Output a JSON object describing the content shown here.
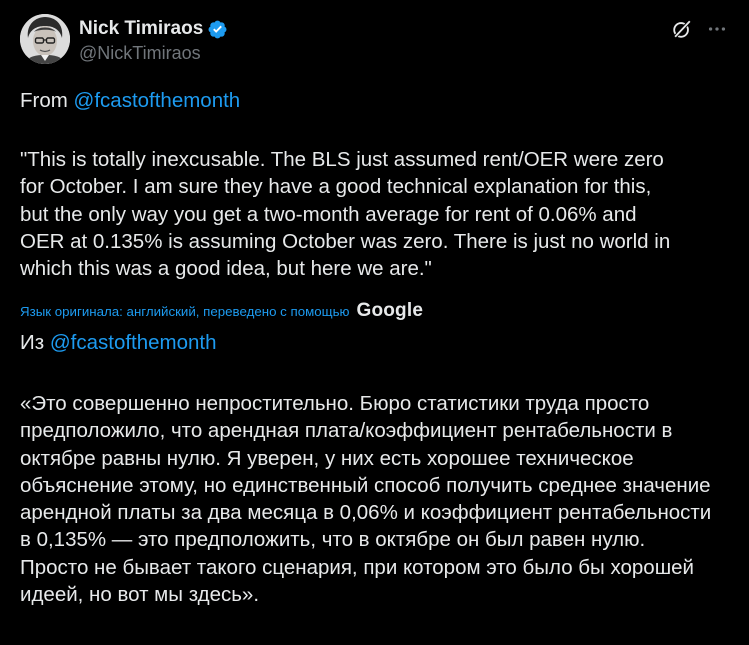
{
  "author": {
    "name": "Nick Timiraos",
    "handle": "@NickTimiraos"
  },
  "icons": {
    "verified": "verified-badge-icon",
    "grok": "grok-icon",
    "more": "more-icon",
    "verified_color": "#1d9bf0",
    "link_color": "#1d9bf0"
  },
  "tweet": {
    "from_prefix": "From ",
    "from_mention": "@fcastofthemonth",
    "quote_lines": [
      "\"This is totally inexcusable. The BLS just assumed rent/OER were zero",
      "for October. I am sure they have a good technical explanation for this,",
      "but the only way you get a two-month average for rent of 0.06% and",
      "OER at 0.135% is assuming October was zero. There is just no world in",
      "which this was a good idea, but here we are.\""
    ],
    "translation_note": "Язык оригинала: английский, переведено с помощью",
    "translation_brand": "Google",
    "from_ru_prefix": "Из ",
    "from_ru_mention": "@fcastofthemonth",
    "quote_ru_lines": [
      "«Это совершенно непростительно. Бюро статистики труда просто",
      "предположило, что арендная плата/коэффициент рентабельности в",
      "октябре равны нулю. Я уверен, у них есть хорошее техническое",
      "объяснение этому, но единственный способ получить среднее значение",
      "арендной платы за два месяца в 0,06% и коэффициент рентабельности",
      "в 0,135% — это предположить, что в октябре он был равен нулю.",
      "Просто не бывает такого сценария, при котором это было бы хорошей",
      "идеей, но вот мы здесь»."
    ]
  }
}
